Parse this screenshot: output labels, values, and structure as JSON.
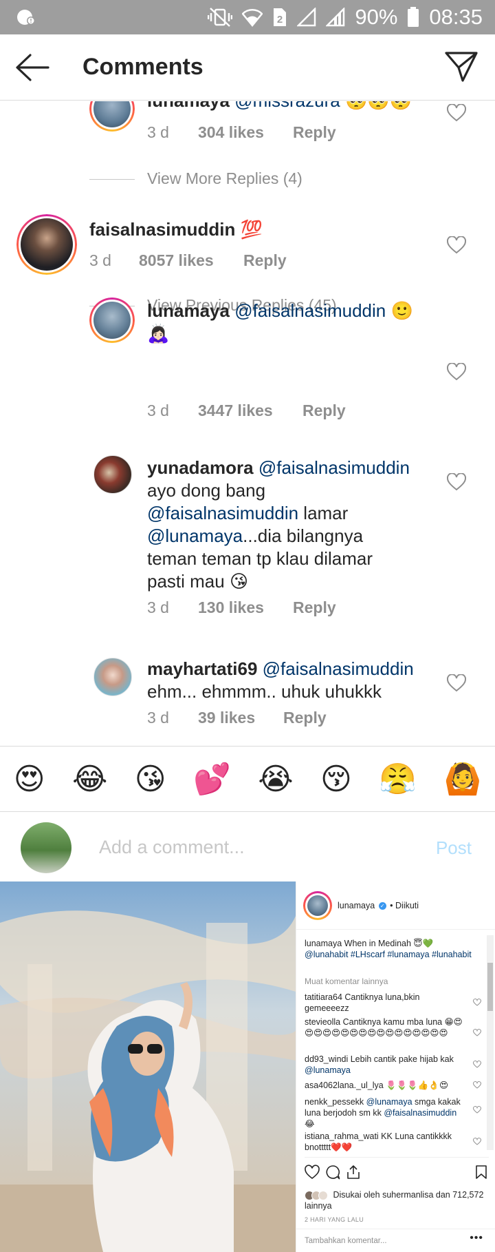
{
  "status_bar": {
    "battery": "90%",
    "time": "08:35"
  },
  "header": {
    "title": "Comments"
  },
  "comments": {
    "partial_top": {
      "username": "lunamaya",
      "mention": "@missrazura",
      "emoji": "🥺🥺🥺",
      "time": "3 d",
      "likes": "304 likes",
      "reply": "Reply"
    },
    "view_more_replies": "View More Replies (4)",
    "main": {
      "username": "faisalnasimuddin",
      "emoji": "💯",
      "time": "3 d",
      "likes": "8057 likes",
      "reply": "Reply"
    },
    "view_previous_replies": "View Previous Replies (45)",
    "replies": [
      {
        "username": "lunamaya",
        "mention": "@faisalnasimuddin",
        "text_line1_tail": " 🙂",
        "text_line2": "🙇🏻‍♀️",
        "time": "3 d",
        "likes": "3447 likes",
        "reply": "Reply"
      },
      {
        "username": "yunadamora",
        "mention": "@faisalnasimuddin",
        "line2": "ayo dong bang",
        "line3_mention": "@faisalnasimuddin",
        "line3_text": " lamar",
        "line4_mention": "@lunamaya",
        "line4_text": "...dia bilangnya",
        "line5": "teman teman tp klau dilamar",
        "line6": "pasti mau 😘",
        "time": "3 d",
        "likes": "130 likes",
        "reply": "Reply"
      },
      {
        "username": "mayhartati69",
        "mention": "@faisalnasimuddin",
        "line2": "ehm... ehmmm.. uhuk uhukkk",
        "time": "3 d",
        "likes": "39 likes",
        "reply": "Reply"
      }
    ]
  },
  "emoji_bar": [
    "😍",
    "😂",
    "😘",
    "💕",
    "😭",
    "😚",
    "😤",
    "🙆"
  ],
  "add_comment": {
    "placeholder": "Add a comment...",
    "post": "Post"
  },
  "embedded_post": {
    "username": "lunamaya",
    "follow_state": "• Diikuti",
    "caption": {
      "username": "lunamaya",
      "text": " When in Medinah 😇💚",
      "tags": "@lunahabit #LHscarf #lunamaya #lunahabit"
    },
    "more_comments": "Muat komentar lainnya",
    "comments": [
      {
        "user": "tatitiara64",
        "text": " Cantiknya luna,bkin gemeeeezz"
      },
      {
        "user": "stevieolla",
        "text": " Cantiknya kamu mba luna 😁😍😍😍😍😍😍😍😍😍😍😍😍😍😍😍😍😍"
      },
      {
        "user": "dd93_windi",
        "text": " Lebih cantik pake hijab kak ",
        "mention": "@lunamaya"
      },
      {
        "user": "asa4062lana._ul_lya",
        "text": " 🌷🌷🌷👍👌😍"
      },
      {
        "user": "nenkk_pessekk",
        "mention": "@lunamaya",
        "text": " smga kakak luna berjodoh sm kk ",
        "mention2": "@faisalnasimuddin",
        "tail": " 😂"
      },
      {
        "user": "istiana_rahma_wati",
        "text": " KK Luna cantikkkk bnottttt❤️❤️"
      }
    ],
    "liked_by": "Disukai oleh ",
    "liked_by_user": "suhermanlisa",
    "liked_by_rest": " dan 712,572 lainnya",
    "time_ago": "2 HARI YANG LALU",
    "add_comment_placeholder": "Tambahkan komentar...",
    "more": "•••"
  }
}
